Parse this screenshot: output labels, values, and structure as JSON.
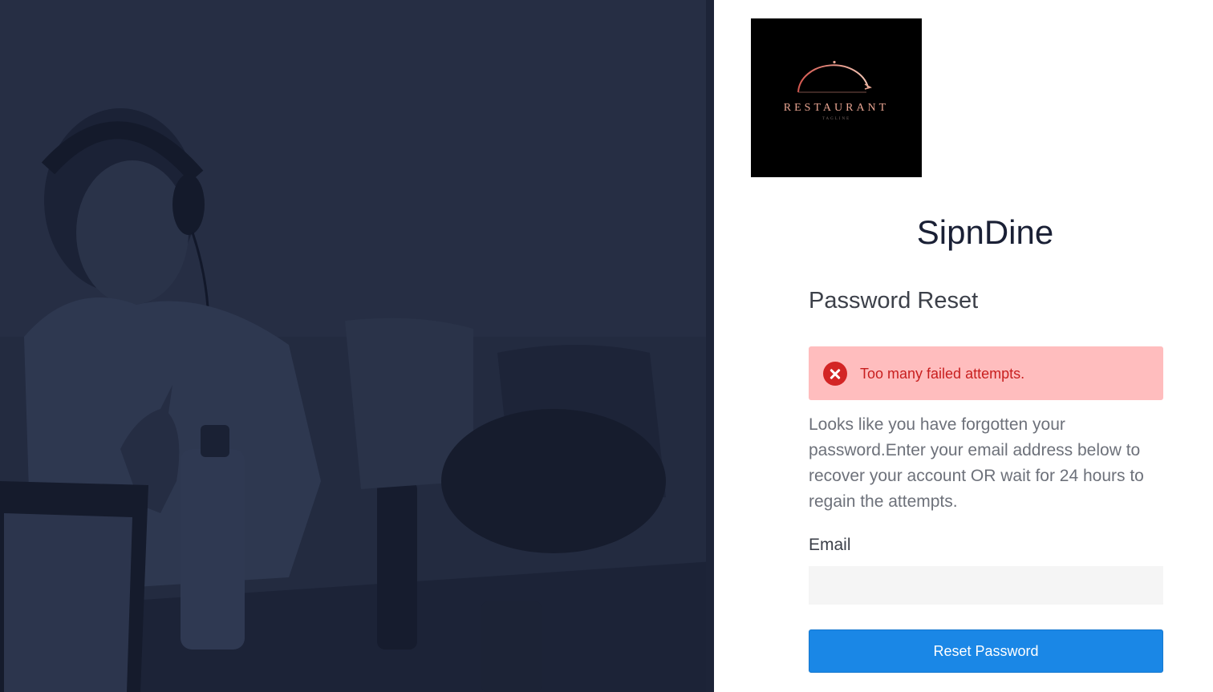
{
  "logo": {
    "brand_text": "RESTAURANT",
    "tagline": "TAGLINE",
    "icon": "cloche-icon",
    "accent_color": "#e8a491"
  },
  "app": {
    "title": "SipnDine"
  },
  "form": {
    "heading": "Password Reset",
    "alert": {
      "icon": "error-circle-icon",
      "message": "Too many failed attempts.",
      "background": "#ffbdbe",
      "color": "#c81f1f"
    },
    "description": "Looks like you have forgotten your password.Enter your email address below to recover your account OR wait for 24 hours to regain the attempts.",
    "email": {
      "label": "Email",
      "value": "",
      "placeholder": ""
    },
    "submit_label": "Reset Password",
    "submit_color": "#1a87e6"
  },
  "hero": {
    "overlay_color": "#222a3f"
  }
}
